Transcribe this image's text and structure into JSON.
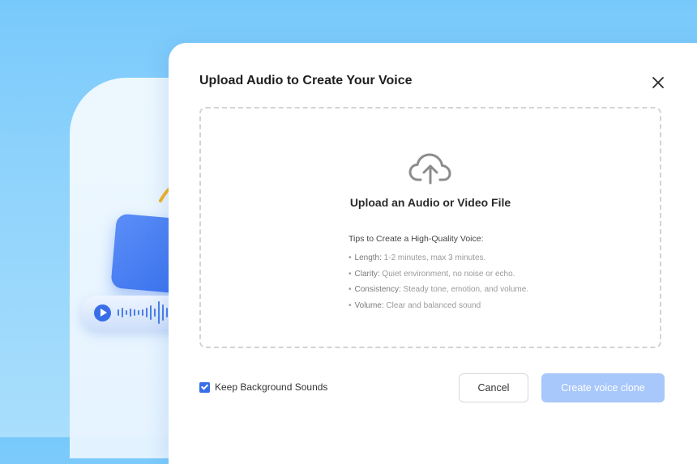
{
  "modal": {
    "title": "Upload Audio to Create Your Voice",
    "close_icon": "close-icon"
  },
  "dropzone": {
    "icon": "cloud-upload-icon",
    "title": "Upload an Audio or Video File",
    "tips_heading": "Tips to Create a High-Quality Voice:",
    "tips": [
      {
        "key": "Length:",
        "text": "1-2 minutes, max 3 minutes."
      },
      {
        "key": "Clarity:",
        "text": "Quiet environment, no noise or echo."
      },
      {
        "key": "Consistency:",
        "text": "Steady tone, emotion, and volume."
      },
      {
        "key": "Volume:",
        "text": "Clear and balanced sound"
      }
    ]
  },
  "footer": {
    "keep_background_label": "Keep Background Sounds",
    "keep_background_checked": true,
    "cancel_label": "Cancel",
    "create_label": "Create voice clone"
  },
  "colors": {
    "accent": "#3a6ee8",
    "create_button_disabled": "#a8c7fa",
    "background": "#78c9fb"
  }
}
